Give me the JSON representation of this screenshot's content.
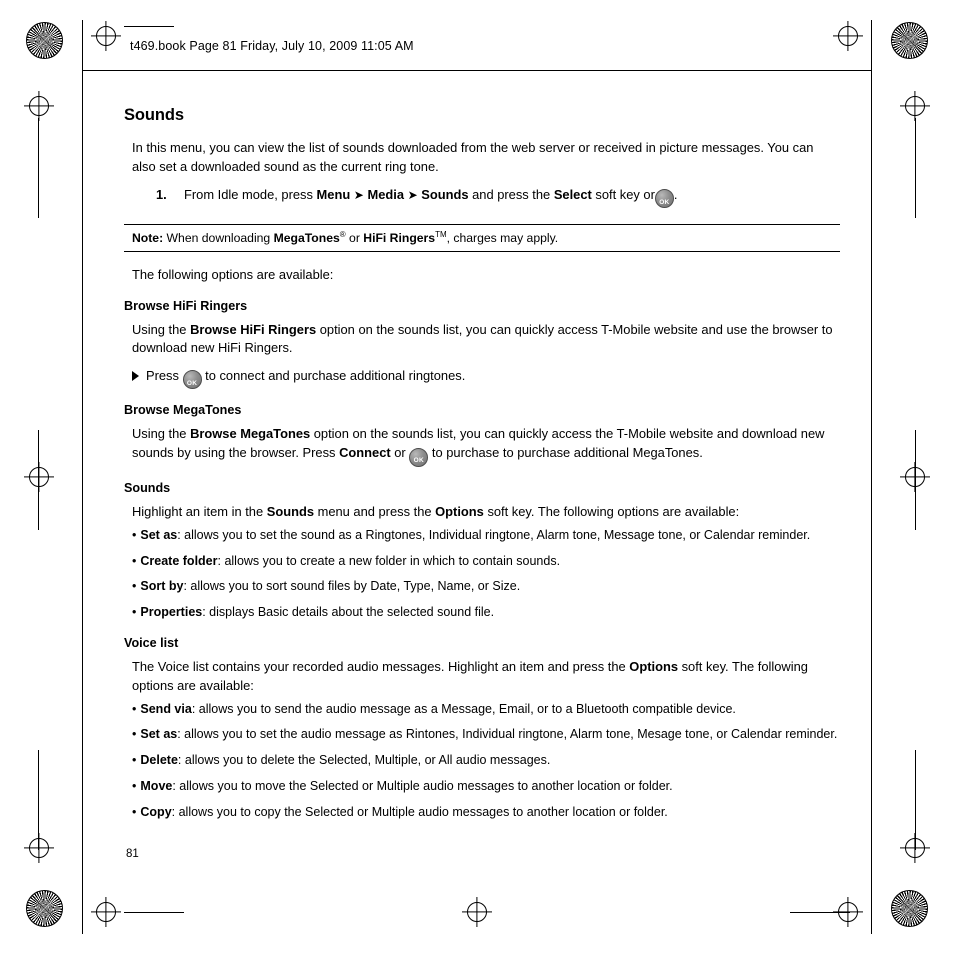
{
  "header": {
    "running_head": "t469.book  Page 81  Friday, July 10, 2009  11:05 AM"
  },
  "page": {
    "number": "81",
    "title": "Sounds"
  },
  "intro": {
    "paragraph": "In this menu, you can view the list of sounds downloaded from the web server or received in picture messages. You can also set a downloaded sound as the current ring tone.",
    "step_number": "1.",
    "step_part1": "From Idle mode, press",
    "step_menu": "Menu",
    "arrow1": "➤",
    "step_media": "Media",
    "arrow2": "➤",
    "step_sounds": "Sounds",
    "step_part2": "and press the",
    "step_select": "Select",
    "step_part3": "soft key or",
    "step_end": "."
  },
  "note": {
    "label": "Note:",
    "text_part1": "When downloading",
    "megatones": "MegaTones",
    "megatones_sup": "®",
    "or": "or",
    "hifi": "HiFi Ringers",
    "hifi_sup": "TM",
    "text_part2": ", charges may apply."
  },
  "options_lead": "The following options are available:",
  "sections": [
    {
      "heading": "Browse HiFi Ringers",
      "body_pre": "Using the",
      "body_bold": "Browse HiFi Ringers",
      "body_post": "option on the sounds list, you can quickly access T-Mobile website and use the browser to download new HiFi Ringers.",
      "arrow_pre": "Press",
      "arrow_post": "to connect and purchase additional ringtones."
    },
    {
      "heading": "Browse MegaTones",
      "body_pre": "Using the",
      "body_bold": "Browse MegaTones",
      "body_mid": "option on the sounds list, you can quickly access the T-Mobile website and download new sounds by using the browser. Press",
      "connect": "Connect",
      "or": "or",
      "body_post": "to purchase to purchase additional MegaTones."
    },
    {
      "heading": "Sounds",
      "body_pre": "Highlight an item in the",
      "body_bold1": "Sounds",
      "body_mid": "menu and press the",
      "body_bold2": "Options",
      "body_post": "soft key. The following options are available:",
      "bullets": [
        {
          "term": "Set as",
          "desc": ": allows you to set the sound as a Ringtones, Individual ringtone, Alarm tone, Message tone, or Calendar reminder."
        },
        {
          "term": "Create folder",
          "desc": ": allows you to create a new folder in which to contain sounds."
        },
        {
          "term": "Sort by",
          "desc": ": allows you to sort sound files by Date, Type, Name, or Size."
        },
        {
          "term": "Properties",
          "desc": ": displays Basic details about the selected sound file."
        }
      ]
    },
    {
      "heading": "Voice list",
      "body_pre": "The Voice list contains your recorded audio messages. Highlight an item and press the",
      "body_bold": "Options",
      "body_post": "soft key. The following options are available:",
      "bullets": [
        {
          "term": "Send via",
          "desc": ": allows you to send the audio message as a Message, Email, or to a Bluetooth compatible device."
        },
        {
          "term": "Set as",
          "desc": ": allows you to set the audio message as Rintones, Individual ringtone, Alarm tone, Mesage tone, or Calendar reminder."
        },
        {
          "term": "Delete",
          "desc": ": allows you to delete the Selected, Multiple, or All audio messages."
        },
        {
          "term": "Move",
          "desc": ": allows you to move the Selected or Multiple audio messages to another location or folder."
        },
        {
          "term": "Copy",
          "desc": ": allows you to copy the Selected or Multiple audio messages to another location or folder."
        }
      ]
    }
  ],
  "icons": {
    "ok_key_label": "OK",
    "bullet_char": "•"
  }
}
